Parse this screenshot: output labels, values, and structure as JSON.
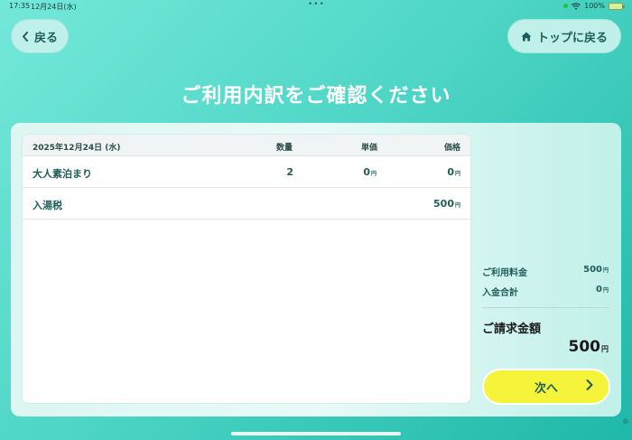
{
  "statusbar": {
    "time": "17:35",
    "date": "12月24日(水)",
    "dots": "•••",
    "battery": "100%"
  },
  "nav": {
    "back_label": "戻る",
    "top_label": "トップに戻る"
  },
  "title": "ご利用内訳をご確認ください",
  "table": {
    "header": {
      "date": "2025年12月24日 (水)",
      "qty": "数量",
      "unit_price": "単価",
      "price": "価格"
    },
    "rows": [
      {
        "name": "大人素泊まり",
        "qty": "2",
        "unit_price": "0",
        "price": "0"
      },
      {
        "name": "入湯税",
        "qty": "",
        "unit_price": "",
        "price": "500"
      }
    ],
    "yen": "円"
  },
  "summary": {
    "usage_label": "ご利用料金",
    "usage_value": "500",
    "deposit_label": "入金合計",
    "deposit_value": "0",
    "bill_label": "ご請求金額",
    "bill_value": "500"
  },
  "next_button": {
    "label": "次へ"
  },
  "colors": {
    "accent": "#4fd6c6",
    "button_yellow": "#f6f43a",
    "text_teal": "#1f5e58"
  }
}
